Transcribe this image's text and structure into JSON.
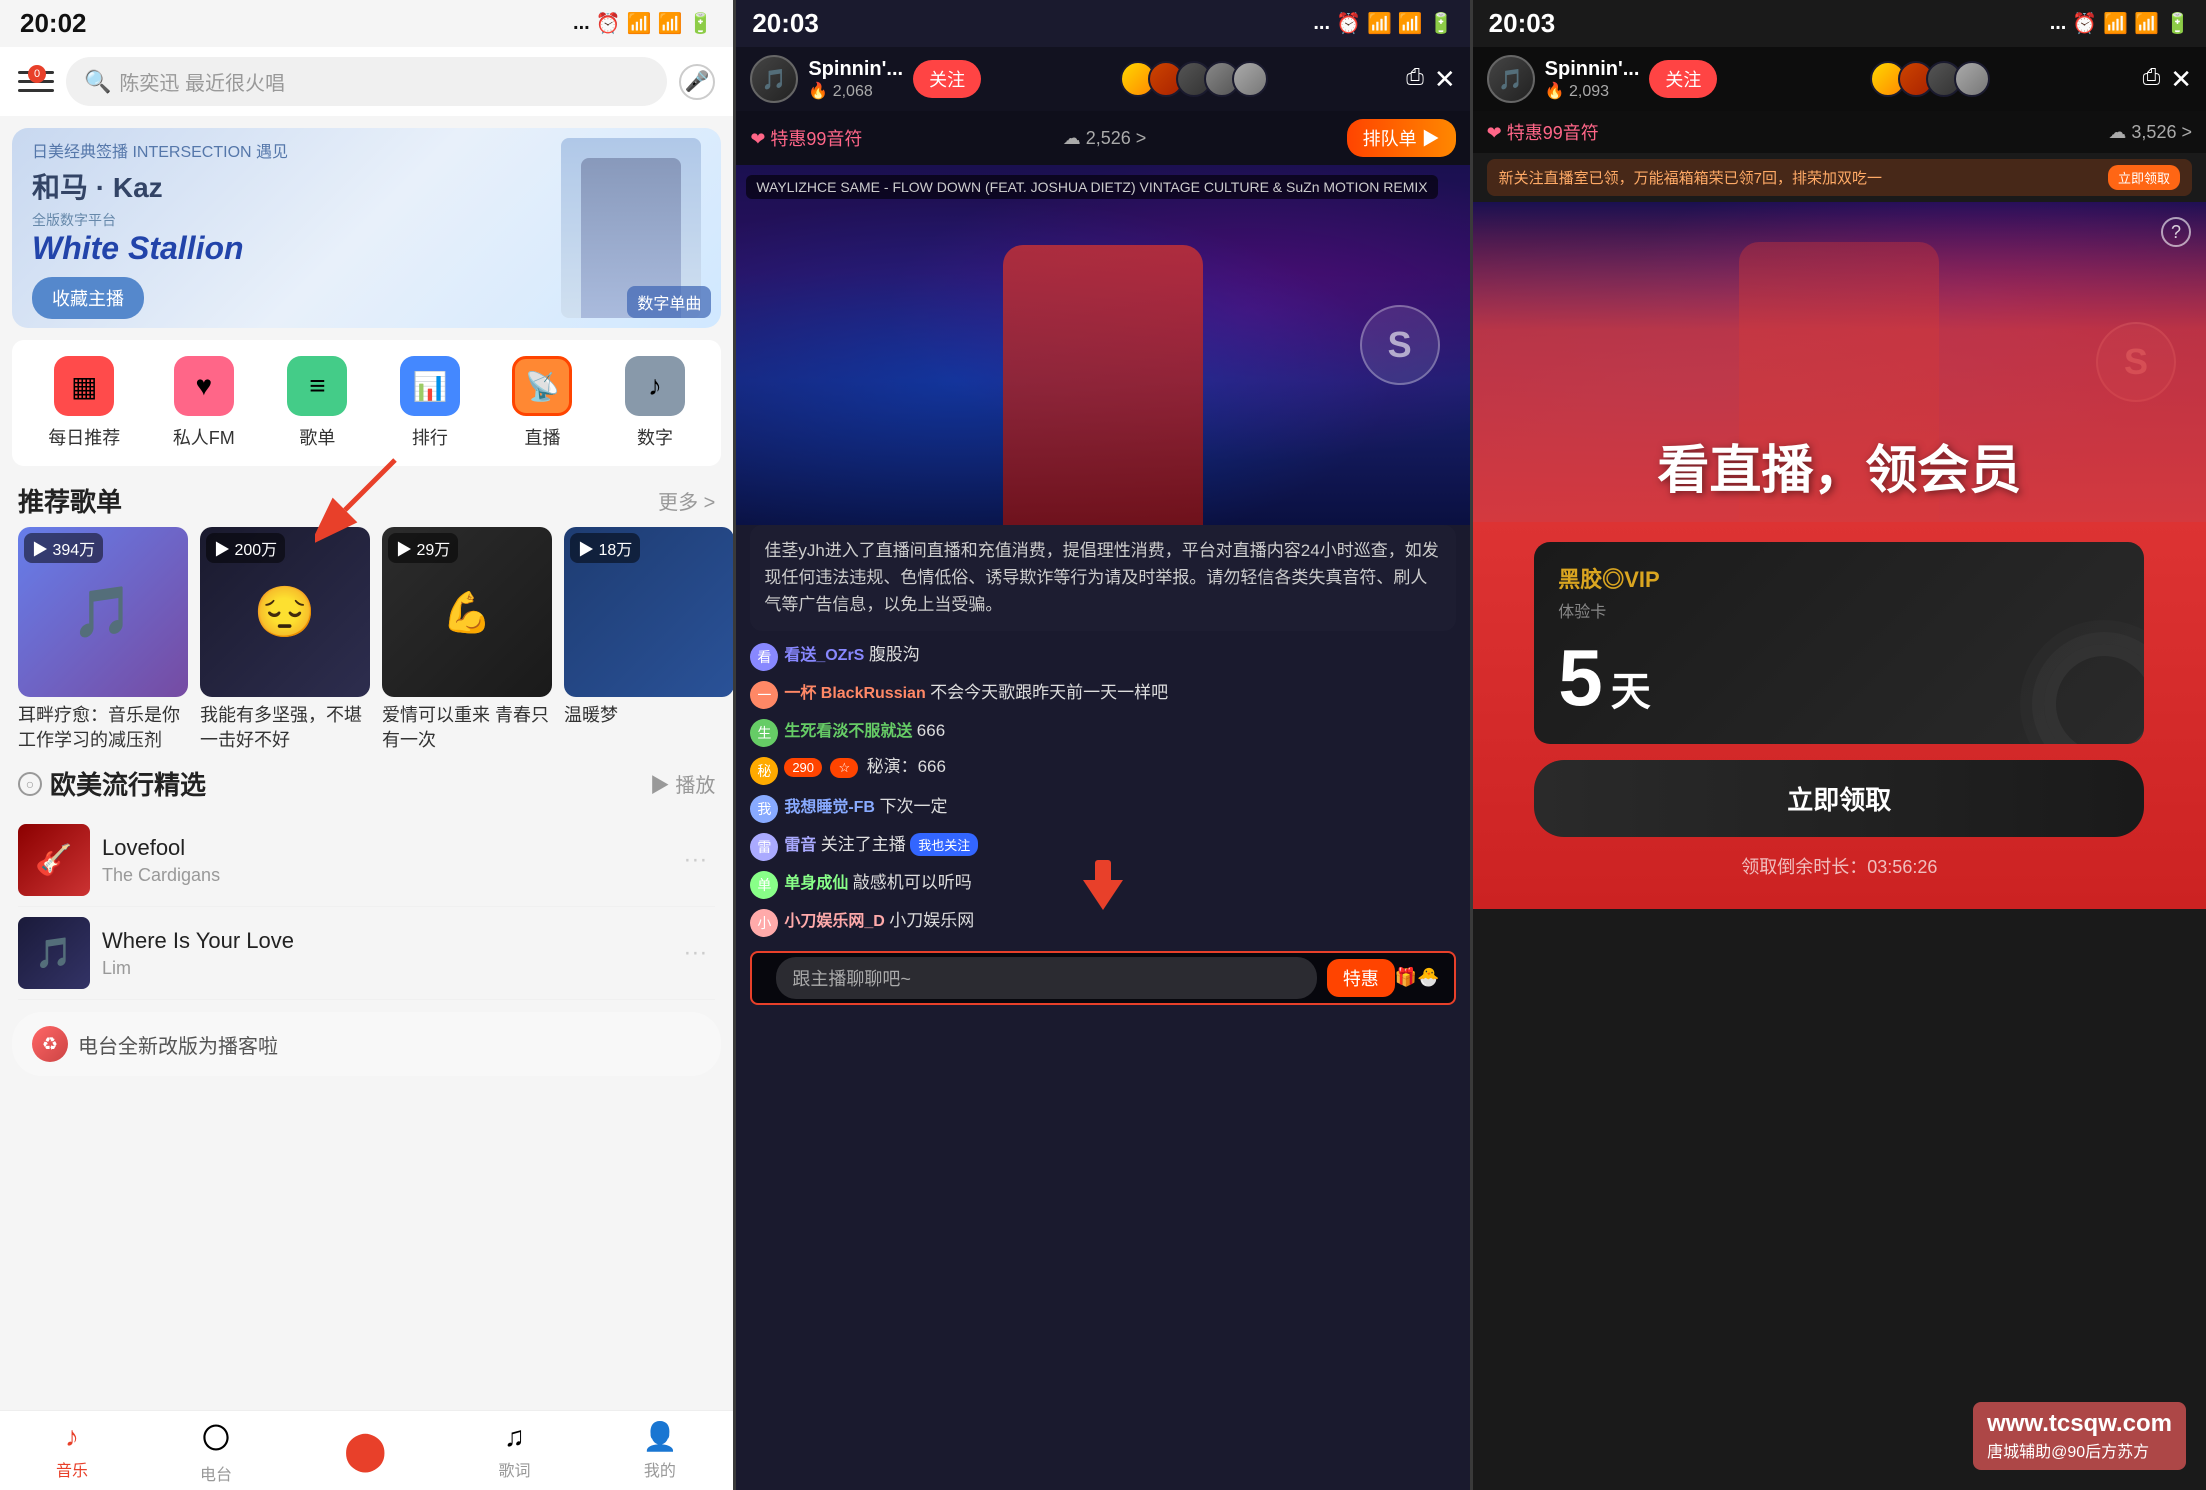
{
  "panels": {
    "panel1": {
      "statusBar": {
        "time": "20:02",
        "icons": "... ⏰ 📶 📶 ♦ 🔋"
      },
      "searchPlaceholder": "陈奕迅 最近很火唱",
      "banner": {
        "subtitle": "日美经典签播 INTERSECTION 遇见",
        "artistName": "和马 · Kaz",
        "albumSubtitle": "全版数字平台",
        "albumTitle": "White Stallion",
        "btnLabel": "收藏主播",
        "tag": "数字单曲"
      },
      "quickActions": [
        {
          "label": "每日推荐",
          "icon": "▦",
          "color": "red"
        },
        {
          "label": "私人FM",
          "icon": "♥",
          "color": "pink"
        },
        {
          "label": "歌单",
          "icon": "≡",
          "color": "green"
        },
        {
          "label": "排行",
          "icon": "📊",
          "color": "blue"
        },
        {
          "label": "直播",
          "icon": "📡",
          "color": "orange"
        },
        {
          "label": "数字",
          "icon": "♪",
          "color": "gray"
        }
      ],
      "recommendSection": {
        "title": "推荐歌单",
        "more": "更多 >",
        "playlists": [
          {
            "playCount": "▶ 394万",
            "name": "耳畔疗愈：音乐是你工作学习的减压剂",
            "coverClass": "cover1"
          },
          {
            "playCount": "▶ 200万",
            "name": "我能有多坚强，不堪一击好不好",
            "coverClass": "cover2"
          },
          {
            "playCount": "▶ 29万",
            "name": "爱情可以重来 青春只有一次",
            "coverClass": "cover3"
          },
          {
            "playCount": "▶ 18万",
            "name": "温暖梦",
            "coverClass": "cover4"
          }
        ]
      },
      "euSection": {
        "title": "欧美流行精选",
        "playLabel": "▶ 播放",
        "songs": [
          {
            "title": "Lovefool",
            "artist": "The Cardigans",
            "coverClass": "cover-lovefool"
          },
          {
            "title": "Where Is Your Love",
            "artist": "Lim",
            "coverClass": "cover-where"
          }
        ]
      },
      "toast": "电台全新改版为播客啦",
      "bottomNav": [
        {
          "label": "音乐",
          "icon": "♪",
          "active": true
        },
        {
          "label": "电台",
          "icon": "〇",
          "active": false
        },
        {
          "label": "",
          "icon": "♦",
          "active": false
        },
        {
          "label": "歌词",
          "icon": "♫",
          "active": false
        },
        {
          "label": "我的",
          "icon": "👤",
          "active": false
        }
      ]
    },
    "panel2": {
      "statusBar": {
        "time": "20:03"
      },
      "streamer": {
        "name": "Spinnin'...",
        "followers": "🔥 2,068",
        "followBtn": "关注"
      },
      "infoBar": {
        "hearts": "❤ 特惠99音符",
        "clouds": "☁ 2,526 >",
        "joinBtn": "排队单 ▶"
      },
      "songTag": "WAYLIZHCE SAME - FLOW DOWN (FEAT. JOSHUA DIETZ) VINTAGE CULTURE & SuZn MOTION REMIX",
      "notifyBar": "佳茎yJh进入了直播间直播和充值消费，提倡理性消费，平台对直播内容24小时巡查，如发现任何违法违规、色情低俗、诱导欺诈等行为请及时举报。请勿轻信各类失真音符、刷人气等广告信息，以免上当受骗。",
      "chats": [
        {
          "name": "看送_OZrS",
          "text": "腹股沟",
          "color": "#8888ff"
        },
        {
          "name": "一杯 BlackRussian",
          "text": "不会今天歌跟昨天前一天一样吧",
          "color": "#ff8866"
        },
        {
          "name": "生死看淡不服就送",
          "text": "666",
          "color": "#66cc66"
        },
        {
          "name": "",
          "text": "秘演：666",
          "badges": [
            "290",
            "☆"
          ],
          "color": "#ffaa00"
        },
        {
          "name": "我想睡觉-FB",
          "text": "下次一定",
          "color": "#88aaff"
        },
        {
          "name": "雷音",
          "text": "关注了主播",
          "followBadge": "我也关注",
          "color": "#aaaaff"
        },
        {
          "name": "单身成仙",
          "text": "敲感机可以听吗",
          "color": "#88ff88"
        },
        {
          "name": "小刀娱乐网_D",
          "text": "小刀娱乐网",
          "color": "#ffaaaa"
        }
      ],
      "bottomInput": "跟主播聊聊吧~",
      "bottomBtns": [
        {
          "label": "特惠",
          "highlighted": true
        },
        {
          "label": "礼物",
          "icon": "🎁"
        },
        {
          "label": "🐥",
          "icon": "🐣"
        }
      ]
    },
    "panel3": {
      "statusBar": {
        "time": "20:03"
      },
      "streamer": {
        "name": "Spinnin'...",
        "followers": "🔥 2,093",
        "followBtn": "关注"
      },
      "infoBar": {
        "hearts": "❤ 特惠99音符",
        "clouds": "☁ 3,526 >"
      },
      "notifyBar": {
        "text": "新关注直播室已领，万能福箱箱荣已领7回，排荣加双吃一",
        "btnLabel": "立即领取"
      },
      "vipOverlay": {
        "title": "看直播，领会员",
        "helpIcon": "?"
      },
      "card": {
        "logo": "黑胶◎VIP",
        "subtitle": "体验卡",
        "days": "5",
        "daysUnit": "天"
      },
      "claimBtn": "立即领取",
      "timer": "领取倒余时长：03:56:26"
    }
  },
  "watermark": {
    "site": "www.tcsqw.com",
    "community": "唐城辅助@90后方苏方"
  }
}
